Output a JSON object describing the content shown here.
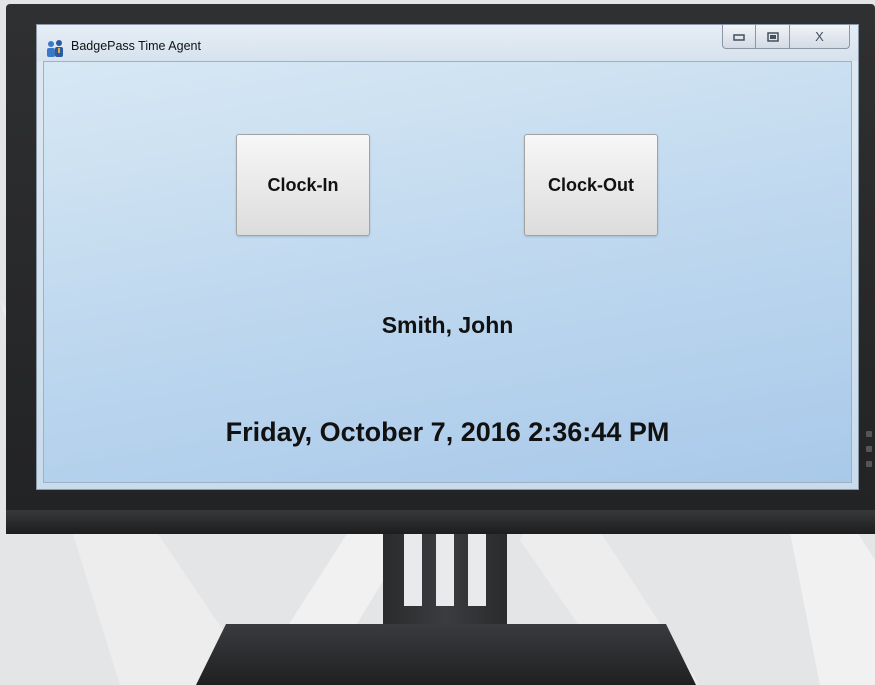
{
  "window": {
    "title": "BadgePass Time Agent",
    "icon": "people-icon",
    "controls": {
      "minimize": "minimize-icon",
      "maximize": "maximize-icon",
      "close_label": "X"
    }
  },
  "actions": {
    "clock_in_label": "Clock-In",
    "clock_out_label": "Clock-Out"
  },
  "employee_name": "Smith, John",
  "current_datetime": "Friday, October 7, 2016 2:36:44 PM",
  "colors": {
    "client_top": "#d7e8f4",
    "client_bottom": "#a9c9ea",
    "bezel": "#2a2b2d",
    "background": "#e4e5e7"
  }
}
